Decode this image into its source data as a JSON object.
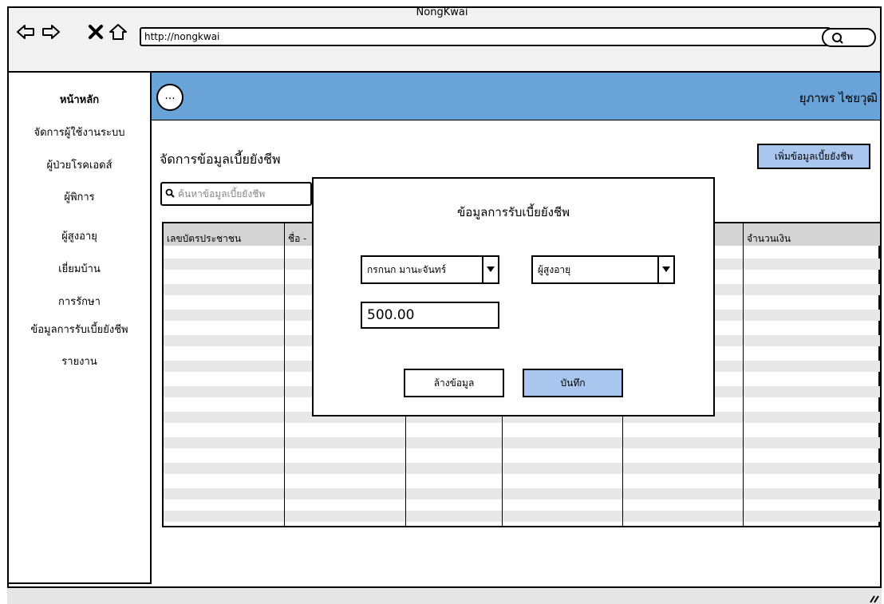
{
  "window": {
    "title": "NongKwai",
    "url": "http://nongkwai"
  },
  "sidebar": {
    "items": [
      {
        "label": "หน้าหลัก"
      },
      {
        "label": "จัดการผู้ใช้งานระบบ"
      },
      {
        "label": "ผู้ป่วยโรคเอดส์"
      },
      {
        "label": "ผู้พิการ"
      },
      {
        "label": "ผู้สูงอายุ"
      },
      {
        "label": "เยี่ยมบ้าน"
      },
      {
        "label": "การรักษา"
      },
      {
        "label": "ข้อมูลการรับเบี้ยยังชีพ"
      },
      {
        "label": "รายงาน"
      }
    ]
  },
  "header": {
    "menu_label": "...",
    "user_name": "ยุภาพร ไชยวุฒิ"
  },
  "main": {
    "title": "จัดการข้อมูลเบี้ยยังชีพ",
    "add_button": "เพิ่มข้อมูลเบี้ยยังชีพ",
    "search_placeholder": "ค้นหาข้อมูลเบี้ยยังชีพ",
    "table": {
      "columns": [
        "เลขบัตรประชาชน",
        "ชื่อ -",
        "จำนวนเงิน"
      ]
    }
  },
  "modal": {
    "title": "ข้อมูลการรับเบี้ยยังชีพ",
    "person_select": "กรกนก มานะจันทร์",
    "type_select": "ผู้สูงอายุ",
    "amount": "500.00",
    "clear_button": "ล้างข้อมูล",
    "save_button": "บันทึก"
  },
  "colors": {
    "header": "#6aa3d8",
    "button": "#a9c6ee",
    "table_header": "#d4d4d4"
  },
  "icons": [
    "back-arrow-icon",
    "forward-arrow-icon",
    "close-icon",
    "home-icon",
    "search-icon",
    "dropdown-arrow-icon",
    "resize-grip-icon"
  ]
}
